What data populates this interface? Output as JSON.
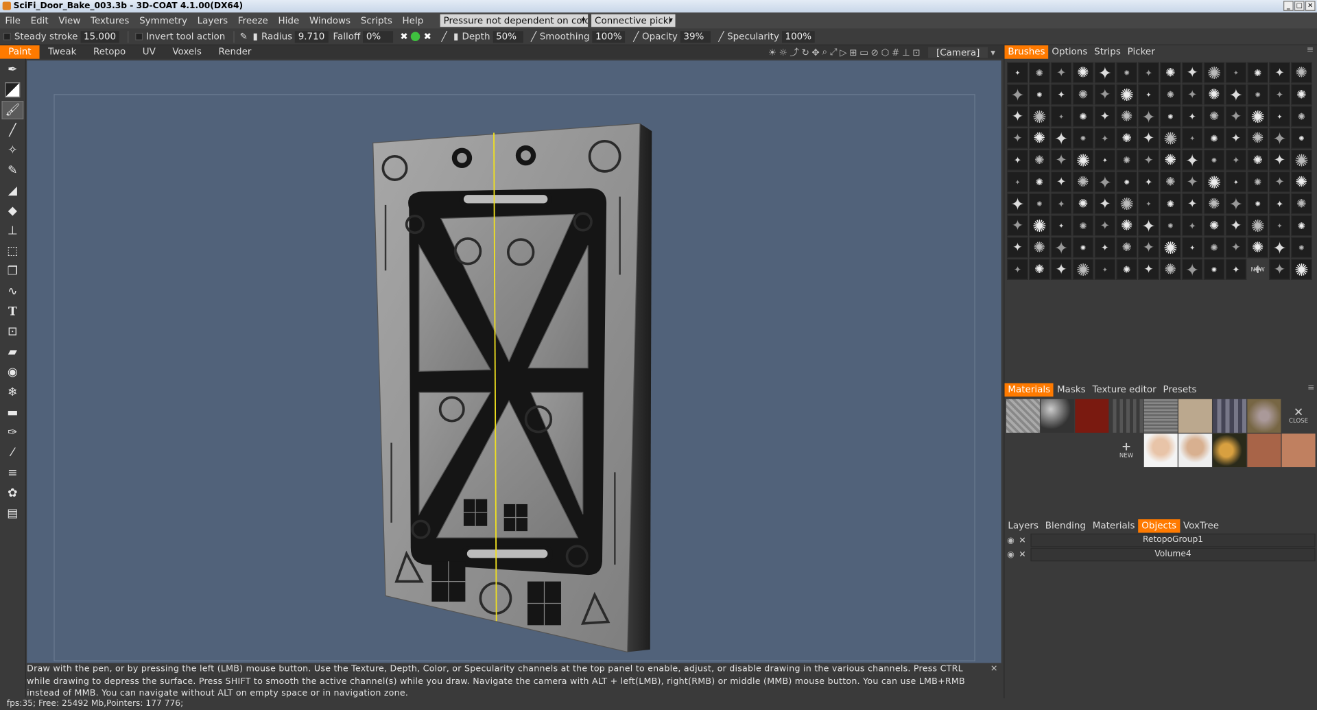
{
  "window": {
    "title": "SciFi_Door_Bake_003.3b - 3D-COAT 4.1.00(DX64)"
  },
  "menu": [
    "File",
    "Edit",
    "View",
    "Textures",
    "Symmetry",
    "Layers",
    "Freeze",
    "Hide",
    "Windows",
    "Scripts",
    "Help"
  ],
  "menu_dropdowns": {
    "pressure": "Pressure not dependent on colo",
    "connective": "Connective picki"
  },
  "toolbar": {
    "steady_stroke_label": "Steady stroke",
    "steady_stroke_value": "15.000",
    "invert_label": "Invert tool action",
    "radius_label": "Radius",
    "radius_value": "9.710",
    "falloff_label": "Falloff",
    "falloff_value": "0%",
    "depth_label": "Depth",
    "depth_value": "50%",
    "smoothing_label": "Smoothing",
    "smoothing_value": "100%",
    "opacity_label": "Opacity",
    "opacity_value": "39%",
    "specularity_label": "Specularity",
    "specularity_value": "100%"
  },
  "rooms": [
    "Paint",
    "Tweak",
    "Retopo",
    "UV",
    "Voxels",
    "Render"
  ],
  "active_room": "Paint",
  "camera_select": "[Camera]",
  "hint_text": "Draw with the pen, or by pressing the left (LMB) mouse button. Use the Texture, Depth, Color, or Specularity channels at the top panel to enable, adjust, or disable drawing in the various channels. Press CTRL while drawing to depress the surface. Press SHIFT to smooth the active channel(s) while you draw. Navigate the camera with ALT + left(LMB), right(RMB)  or middle (MMB) mouse button. You can use LMB+RMB instead of MMB. You can navigate without ALT on empty space or in navigation zone.",
  "status": "fps:35;     Free: 25492 Mb,Pointers: 177 776;",
  "brushes_panel": {
    "tabs": [
      "Brushes",
      "Options",
      "Strips",
      "Picker"
    ],
    "active": "Brushes",
    "new_label": "NEW"
  },
  "materials_panel": {
    "tabs": [
      "Materials",
      "Masks",
      "Texture editor",
      "Presets"
    ],
    "active": "Materials",
    "close_label": "CLOSE",
    "new_label": "NEW"
  },
  "objects_panel": {
    "tabs": [
      "Layers",
      "Blending",
      "Materials",
      "Objects",
      "VoxTree"
    ],
    "active": "Objects",
    "objects": [
      "RetopoGroup1",
      "Volume4"
    ]
  },
  "colors": {
    "accent": "#ff7a00",
    "viewport_bg": "#51627a",
    "symmetry_line": "#f0e020"
  }
}
